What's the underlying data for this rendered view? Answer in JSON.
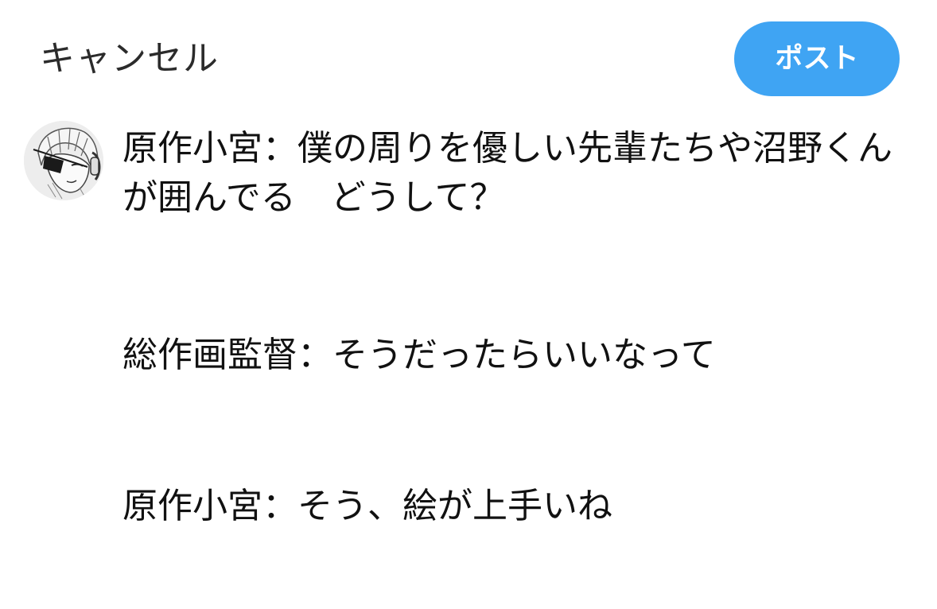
{
  "header": {
    "cancel_label": "キャンセル",
    "post_label": "ポスト",
    "post_color": "#3fa4f3"
  },
  "composer": {
    "avatar_icon": "user-avatar",
    "lines": [
      "原作小宮：僕の周りを優しい先輩たちや沼野くんが囲んでる　どうして？",
      "総作画監督：そうだったらいいなって",
      "原作小宮：そう、絵が上手いね"
    ]
  }
}
